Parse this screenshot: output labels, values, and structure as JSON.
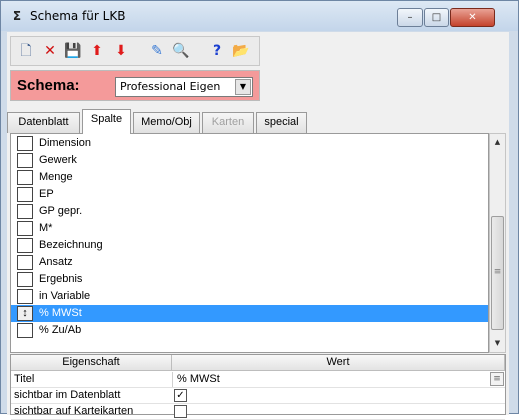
{
  "window": {
    "app_icon": "Σ",
    "title": "Schema für LKB",
    "controls": {
      "minimize": "–",
      "maximize": "□",
      "close": "✕"
    }
  },
  "toolbar": {
    "buttons": [
      {
        "name": "new-icon",
        "glyph": "🗋"
      },
      {
        "name": "delete-icon",
        "glyph": "✕"
      },
      {
        "name": "save-icon",
        "glyph": "💾"
      },
      {
        "name": "move-up-icon",
        "glyph": "⬆"
      },
      {
        "name": "move-down-icon",
        "glyph": "⬇"
      },
      {
        "name": "edit-icon",
        "glyph": "✎"
      },
      {
        "name": "preview-icon",
        "glyph": "🔍"
      },
      {
        "name": "help-icon",
        "glyph": "?"
      },
      {
        "name": "open-folder-icon",
        "glyph": "📂"
      }
    ]
  },
  "schema": {
    "label": "Schema:",
    "selected": "Professional Eigen",
    "arrow": "▼"
  },
  "tabs": [
    {
      "label": "Datenblatt"
    },
    {
      "label": "Spalte"
    },
    {
      "label": "Memo/Obj"
    },
    {
      "label": "Karten"
    },
    {
      "label": "special"
    }
  ],
  "columns_list": {
    "items": [
      {
        "label": "Dimension"
      },
      {
        "label": "Gewerk"
      },
      {
        "label": "Menge"
      },
      {
        "label": "EP"
      },
      {
        "label": "GP gepr."
      },
      {
        "label": "M*"
      },
      {
        "label": "Bezeichnung"
      },
      {
        "label": "Ansatz"
      },
      {
        "label": "Ergebnis"
      },
      {
        "label": "in Variable"
      },
      {
        "label": "% MWSt",
        "box": "↕"
      },
      {
        "label": "% Zu/Ab"
      }
    ],
    "selected_index": 10
  },
  "scrollbar": {
    "up": "▲",
    "down": "▼",
    "grip": "≡"
  },
  "properties": {
    "header": {
      "name": "Eigenschaft",
      "value": "Wert"
    },
    "rows": [
      {
        "name": "Titel",
        "value": "% MWSt"
      },
      {
        "name": "sichtbar im Datenblatt",
        "checked": "✓"
      },
      {
        "name": "sichtbar auf Karteikarten",
        "checked": ""
      }
    ],
    "ellipsis": "≡"
  },
  "colors": {
    "selection": "#3399ff",
    "schema_bar": "#f49a9a",
    "close_button": "#c4432c"
  }
}
